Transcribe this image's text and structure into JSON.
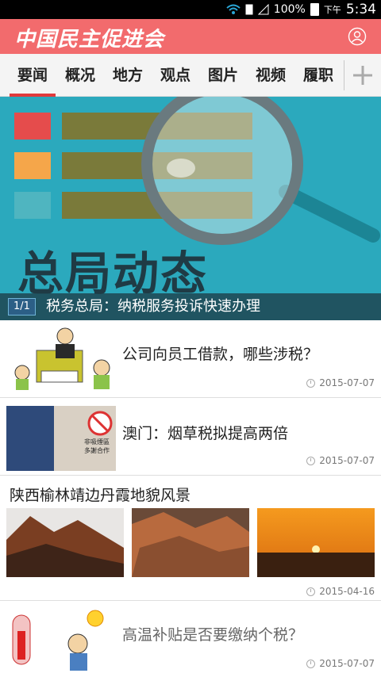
{
  "status_bar": {
    "battery": "100%",
    "ampm": "下午",
    "time": "5:34"
  },
  "header": {
    "logo": "中国民主促进会"
  },
  "tabs": [
    "要闻",
    "概况",
    "地方",
    "观点",
    "图片",
    "视频",
    "履职"
  ],
  "banner": {
    "image_text": "总局动态",
    "page_indicator": "1/1",
    "caption": "税务总局：纳税服务投诉快速办理"
  },
  "news": [
    {
      "title": "公司向员工借款，哪些涉税？",
      "date": "2015-07-07"
    },
    {
      "title": "澳门：烟草税拟提高两倍",
      "date": "2015-07-07",
      "sign_text": [
        "非吸煙區",
        "多謝合作"
      ]
    },
    {
      "title": "高温补贴是否要缴纳个税？",
      "date": "2015-07-07"
    }
  ],
  "gallery": {
    "title": "陕西榆林靖边丹霞地貌风景",
    "date": "2015-04-16"
  },
  "colors": {
    "accent": "#f26b6d",
    "active_tab": "#e03a3c",
    "banner_bg": "#2ba9bd"
  }
}
